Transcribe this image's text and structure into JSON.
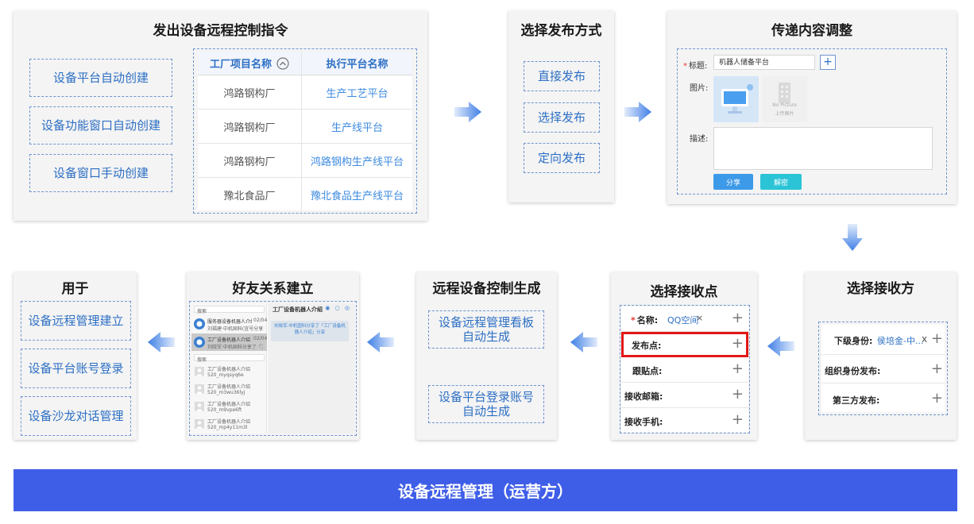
{
  "panels": {
    "cmd": {
      "title": "发出设备远程控制指令",
      "options": [
        "设备平台自动创建",
        "设备功能窗口自动创建",
        "设备窗口手动创建"
      ],
      "table": {
        "headers": [
          "工厂项目名称",
          "执行平台名称"
        ],
        "rows": [
          [
            "鸿路钢构厂",
            "生产工艺平台"
          ],
          [
            "鸿路钢构厂",
            "生产线平台"
          ],
          [
            "鸿路钢构厂",
            "鸿路钢构生产线平台"
          ],
          [
            "豫北食品厂",
            "豫北食品生产线平台"
          ]
        ]
      }
    },
    "publish": {
      "title": "选择发布方式",
      "options": [
        "直接发布",
        "选择发布",
        "定向发布"
      ]
    },
    "content": {
      "title": "传递内容调整",
      "title_label": "标题:",
      "title_value": "机器人储备平台",
      "image_label": "图片:",
      "no_picture": "No Picture",
      "upload_label": "上传图片",
      "desc_label": "描述:",
      "share_btn": "分享",
      "reject_btn": "解密"
    },
    "receiver": {
      "title": "选择接收方",
      "rows": [
        {
          "label": "下级身份:",
          "tag": "侯培金-中...",
          "close": "x"
        },
        {
          "label": "组织身份发布:"
        },
        {
          "label": "第三方发布:"
        }
      ]
    },
    "point": {
      "title": "选择接收点",
      "rows": [
        {
          "label": "名称:",
          "tag": "QQ空间",
          "close": "×",
          "required": true
        },
        {
          "label": "发布点:",
          "highlight": true
        },
        {
          "label": "跟贴点:"
        },
        {
          "label": "接收邮箱:"
        },
        {
          "label": "接收手机:"
        }
      ]
    },
    "remote": {
      "title": "远程设备控制生成",
      "options": [
        "设备远程管理看板自动生成",
        "设备平台登录账号自动生成"
      ]
    },
    "friend": {
      "title": "好友关系建立",
      "search": "搜索",
      "chat_title": "工厂设备机器人介绍",
      "chat_bubble": "刘晓军·中机国科分享了「工厂设备机器人介绍」分享",
      "list": [
        {
          "name": "服务器设备机器人介绍",
          "time": "02/04",
          "sub": "刘福建·中机国科(宜号分享)"
        },
        {
          "name": "工厂设备机器人介绍",
          "time": "02/04",
          "sub": "刘晓军·中机国科分享了「工...」"
        }
      ],
      "contacts": [
        {
          "name": "工厂设备机器人介绍",
          "sub": "520_myqsyq6e"
        },
        {
          "name": "工厂设备机器人介绍",
          "sub": "520_m3wu36lyj"
        },
        {
          "name": "工厂设备机器人介绍",
          "sub": "520_m9vpe6ft"
        },
        {
          "name": "工厂设备机器人介绍",
          "sub": "520_mp4y11m3l"
        }
      ]
    },
    "usage": {
      "title": "用于",
      "options": [
        "设备远程管理建立",
        "设备平台账号登录",
        "设备沙龙对话管理"
      ]
    }
  },
  "footer": {
    "label": "设备远程管理（运营方）",
    "color": "#3f5ee8"
  },
  "colors": {
    "accent": "#2d6fc4",
    "arrow": "#3f7fe6",
    "highlight": "#e31818"
  }
}
